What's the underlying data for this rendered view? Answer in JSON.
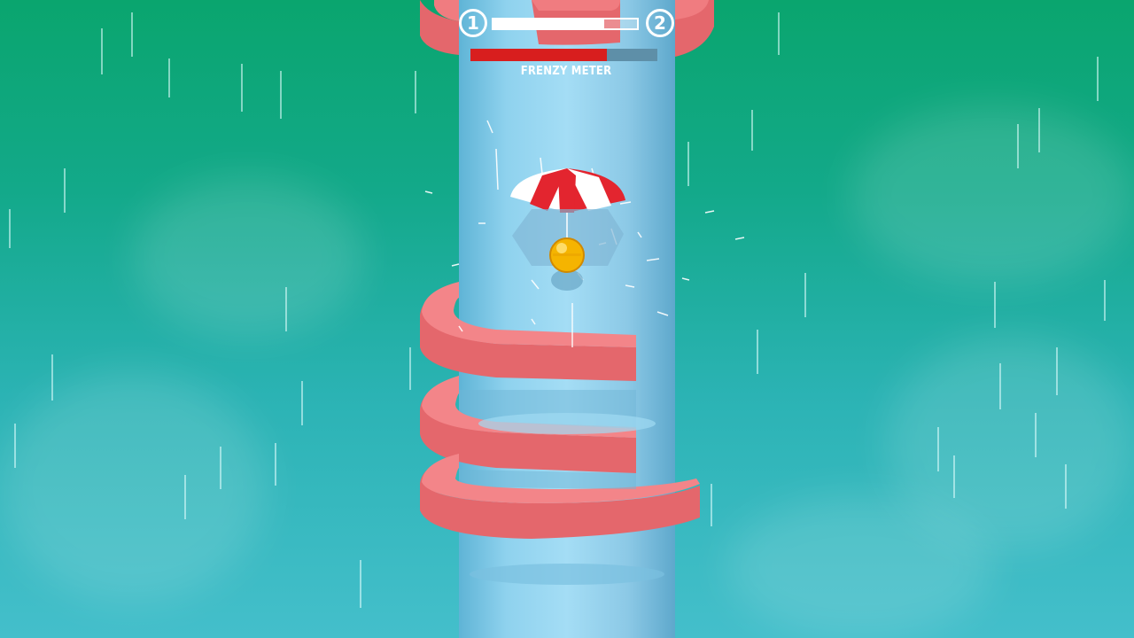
{
  "hud": {
    "current_level": "1",
    "next_level": "2",
    "level_progress": 0.77,
    "frenzy_meter_label": "FRENZY METER",
    "frenzy_level": 0.73
  },
  "colors": {
    "sky_top": "#0aa56e",
    "sky_bottom": "#44bfcb",
    "tower": "#a4ddf5",
    "platform": "#f07c80",
    "frenzy_fill": "#d81e1e",
    "ball": "#f5b400",
    "umbrella_red": "#e3252f"
  },
  "scene": {
    "ball": "yellow-ball",
    "power_up": "umbrella-parachute-icon",
    "weather": "rain"
  }
}
